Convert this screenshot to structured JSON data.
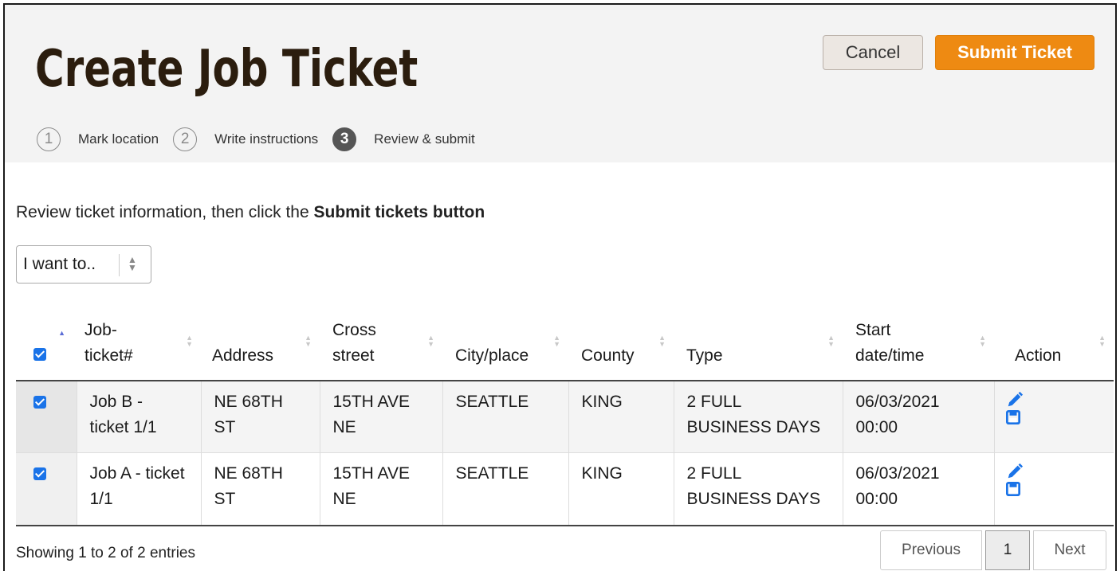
{
  "header": {
    "title": "Create Job Ticket",
    "cancel_label": "Cancel",
    "submit_label": "Submit Ticket",
    "steps": [
      {
        "number": "1",
        "label": "Mark location",
        "active": false
      },
      {
        "number": "2",
        "label": "Write instructions",
        "active": false
      },
      {
        "number": "3",
        "label": "Review & submit",
        "active": true
      }
    ]
  },
  "instructions": {
    "prefix": "Review ticket information, then click the ",
    "emphasis": "Submit tickets button"
  },
  "action_select": {
    "selected": "I want to.."
  },
  "table": {
    "columns": [
      "Job-\nticket#",
      "Address",
      "Cross\nstreet",
      "City/place",
      "County",
      "Type",
      "Start\ndate/time",
      "Action"
    ],
    "rows": [
      {
        "checked": true,
        "job": "Job B -\nticket 1/1",
        "address": "NE 68TH\nST",
        "cross": "15TH AVE\nNE",
        "city": "SEATTLE",
        "county": "KING",
        "type": "2 FULL\nBUSINESS DAYS",
        "start": "06/03/2021\n00:00"
      },
      {
        "checked": true,
        "job": "Job A - ticket\n1/1",
        "address": "NE 68TH\nST",
        "cross": "15TH AVE\nNE",
        "city": "SEATTLE",
        "county": "KING",
        "type": "2 FULL\nBUSINESS DAYS",
        "start": "06/03/2021\n00:00"
      }
    ]
  },
  "footer": {
    "summary": "Showing 1 to 2 of 2 entries",
    "prev_label": "Previous",
    "page_label": "1",
    "next_label": "Next"
  },
  "colors": {
    "submit": "#ee8a12",
    "title": "#2b1d0e",
    "icon_blue": "#1a73e8"
  },
  "icons": [
    "pencil-icon",
    "save-icon",
    "checkbox-icon",
    "sort-icon",
    "select-arrows-icon"
  ]
}
